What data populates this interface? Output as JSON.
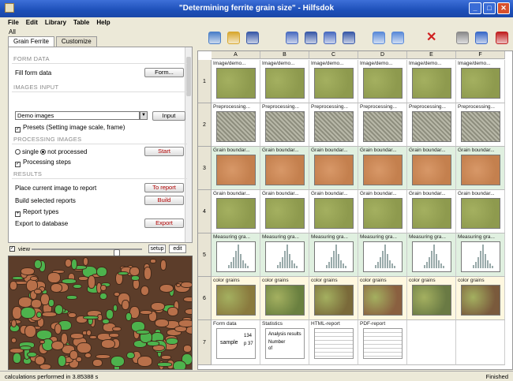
{
  "window": {
    "title": "\"Determining ferrite grain size\" - Hilfsdok"
  },
  "menu": [
    "File",
    "Edit",
    "Library",
    "Table",
    "Help"
  ],
  "left": {
    "all_label": "All",
    "tabs": [
      "Grain Ferrite",
      "Customize"
    ],
    "sections": {
      "form": "FORM DATA",
      "images": "IMAGES INPUT",
      "processing": "PROCESSING IMAGES",
      "results": "RESULTS"
    },
    "form_data_label": "Fill form data",
    "form_btn": "Form...",
    "image_source": "Demo images",
    "input_btn": "Input",
    "presets_label": "Presets (Setting image scale, frame)",
    "single_label": "single",
    "not_processed_label": "not processed",
    "start_btn": "Start",
    "steps_label": "Processing steps",
    "place_label": "Place current image to report",
    "to_report_btn": "To report",
    "build_label": "Build selected reports",
    "build_btn": "Build",
    "report_types_label": "Report types",
    "export_label": "Export to database",
    "export_btn": "Export",
    "zoom_label": "view",
    "setup_btn": "setup",
    "edit_btn": "edit"
  },
  "grid": {
    "columns": [
      "A",
      "B",
      "C",
      "D",
      "E",
      "F"
    ],
    "rows": [
      {
        "num": "1",
        "label": "Image/demo...",
        "kind": "green",
        "color": "#8e9a4e"
      },
      {
        "num": "2",
        "label": "Preprocessing...",
        "kind": "gray",
        "color": "#a8a896"
      },
      {
        "num": "3",
        "label": "Grain boundar...",
        "kind": "orange",
        "color": "#c4804e"
      },
      {
        "num": "4",
        "label": "Grain boundar...",
        "kind": "green",
        "color": "#8e9a4e"
      },
      {
        "num": "5",
        "label": "Measuring gra...",
        "kind": "graph",
        "color": "#ffffff"
      },
      {
        "num": "6",
        "label": "color grains",
        "kind": "mixed",
        "color": "#7a7240"
      },
      {
        "num": "7",
        "label": "",
        "kind": "report",
        "color": "#ffffff"
      }
    ],
    "row7_labels": [
      "Form data",
      "Statistics",
      "HTML-report",
      "PDF-report"
    ],
    "form_card": {
      "sample": "sample",
      "a": "134",
      "b": "p 37"
    },
    "stats_card": {
      "title": "Analysis results",
      "line1": "Number",
      "line2": "of"
    }
  },
  "status": {
    "left": "calculations performed in 3.85388 s",
    "right": "Finished"
  },
  "colors": {
    "title": "#1d4fb8",
    "grain_green": "#4db34d",
    "grain_brown": "#b8704a"
  }
}
